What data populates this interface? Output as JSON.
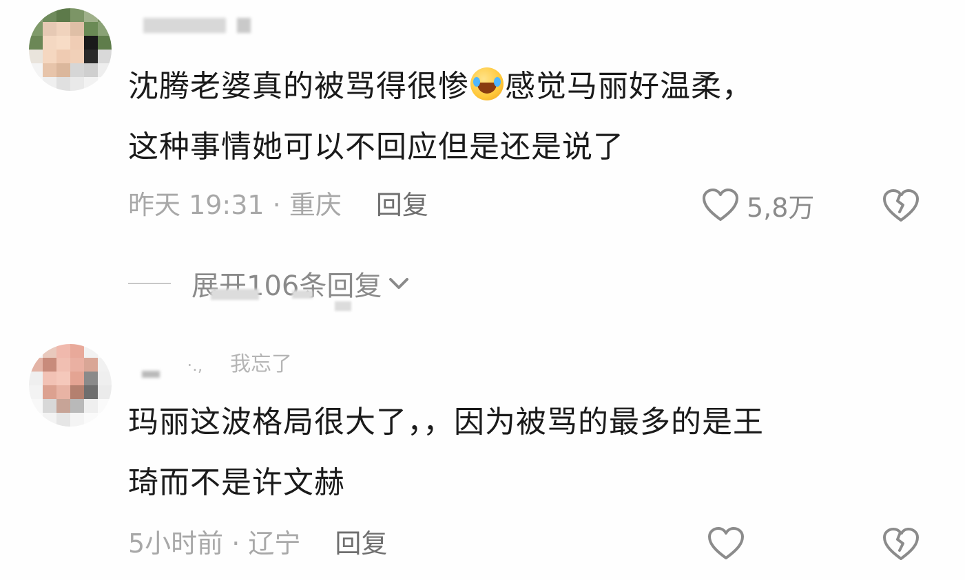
{
  "comments": [
    {
      "text_line1": "沈腾老婆真的被骂得很惨",
      "emoji": "rofl-emoji",
      "text_line1_tail": "感觉马丽好温柔，",
      "text_line2": "这种事情她可以不回应但是还是说了",
      "meta": "昨天 19:31 · 重庆",
      "reply_label": "回复",
      "like_count": "5,8万",
      "username_visible": "",
      "replies_toggle": "展开106条回复"
    },
    {
      "username_visible": "我忘了",
      "text_line1": "玛丽这波格局很大了，，因为被骂的最多的是王",
      "text_line2": "琦而不是许文赫",
      "meta": "5小时前 · 辽宁",
      "reply_label": "回复",
      "like_count": ""
    }
  ],
  "colors": {
    "background": "#fefefe",
    "text": "#1a1a1a",
    "meta": "#a8a8a8",
    "reply": "#6f6f6f",
    "icon": "#8b8b8b"
  }
}
